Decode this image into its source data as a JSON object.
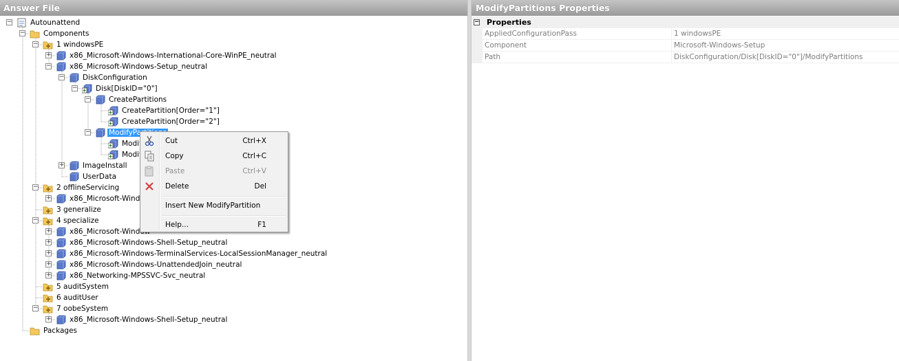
{
  "left_panel": {
    "title": "Answer File"
  },
  "right_panel": {
    "title": "ModifyPartitions Properties"
  },
  "tree": [
    {
      "label": "Autounattend",
      "icon": "answer-file-icon",
      "expander": "minus"
    },
    {
      "label": "Components",
      "icon": "folder-icon",
      "expander": "minus"
    },
    {
      "label": "1 windowsPE",
      "icon": "configuration-pass-icon",
      "expander": "minus"
    },
    {
      "label": "x86_Microsoft-Windows-International-Core-WinPE_neutral",
      "icon": "component-icon",
      "expander": "plus"
    },
    {
      "label": "x86_Microsoft-Windows-Setup_neutral",
      "icon": "component-icon",
      "expander": "minus"
    },
    {
      "label": "DiskConfiguration",
      "icon": "component-icon",
      "expander": "minus"
    },
    {
      "label": "Disk[DiskID=\"0\"]",
      "icon": "list-item-icon",
      "expander": "minus"
    },
    {
      "label": "CreatePartitions",
      "icon": "component-icon",
      "expander": "minus"
    },
    {
      "label": "CreatePartition[Order=\"1\"]",
      "icon": "list-item-icon",
      "expander": ""
    },
    {
      "label": "CreatePartition[Order=\"2\"]",
      "icon": "list-item-icon",
      "expander": ""
    },
    {
      "label": "ModifyPartitions",
      "icon": "component-icon",
      "expander": "minus",
      "selected": true
    },
    {
      "label": "Modify",
      "icon": "list-item-icon",
      "expander": ""
    },
    {
      "label": "Modify",
      "icon": "list-item-icon",
      "expander": ""
    },
    {
      "label": "ImageInstall",
      "icon": "component-icon",
      "expander": "plus"
    },
    {
      "label": "UserData",
      "icon": "component-icon",
      "expander": ""
    },
    {
      "label": "2 offlineServicing",
      "icon": "configuration-pass-icon",
      "expander": "minus"
    },
    {
      "label": "x86_Microsoft-Window",
      "icon": "component-icon",
      "expander": "plus"
    },
    {
      "label": "3 generalize",
      "icon": "configuration-pass-icon",
      "expander": ""
    },
    {
      "label": "4 specialize",
      "icon": "configuration-pass-icon",
      "expander": "minus"
    },
    {
      "label": "x86_Microsoft-Window",
      "icon": "component-icon",
      "expander": "plus"
    },
    {
      "label": "x86_Microsoft-Windows-Shell-Setup_neutral",
      "icon": "component-icon",
      "expander": "plus"
    },
    {
      "label": "x86_Microsoft-Windows-TerminalServices-LocalSessionManager_neutral",
      "icon": "component-icon",
      "expander": "plus"
    },
    {
      "label": "x86_Microsoft-Windows-UnattendedJoin_neutral",
      "icon": "component-icon",
      "expander": "plus"
    },
    {
      "label": "x86_Networking-MPSSVC-Svc_neutral",
      "icon": "component-icon",
      "expander": "plus"
    },
    {
      "label": "5 auditSystem",
      "icon": "configuration-pass-icon",
      "expander": ""
    },
    {
      "label": "6 auditUser",
      "icon": "configuration-pass-icon",
      "expander": ""
    },
    {
      "label": "7 oobeSystem",
      "icon": "configuration-pass-icon",
      "expander": "minus"
    },
    {
      "label": "x86_Microsoft-Windows-Shell-Setup_neutral",
      "icon": "component-icon",
      "expander": "plus"
    },
    {
      "label": "Packages",
      "icon": "folder-icon",
      "expander": ""
    }
  ],
  "context_menu": {
    "items": [
      {
        "label": "Cut",
        "shortcut": "Ctrl+X",
        "icon": "cut-icon",
        "enabled": true
      },
      {
        "label": "Copy",
        "shortcut": "Ctrl+C",
        "icon": "copy-icon",
        "enabled": true
      },
      {
        "label": "Paste",
        "shortcut": "Ctrl+V",
        "icon": "paste-icon",
        "enabled": false
      },
      {
        "label": "Delete",
        "shortcut": "Del",
        "icon": "delete-icon",
        "enabled": true
      },
      {
        "label": "Insert New ModifyPartition",
        "shortcut": "",
        "icon": "",
        "enabled": true
      },
      {
        "label": "Help...",
        "shortcut": "F1",
        "icon": "",
        "enabled": true
      }
    ]
  },
  "properties": {
    "category": "Properties",
    "category_expander": "minus",
    "rows": [
      {
        "name": "AppliedConfigurationPass",
        "value": "1 windowsPE"
      },
      {
        "name": "Component",
        "value": "Microsoft-Windows-Setup"
      },
      {
        "name": "Path",
        "value": "DiskConfiguration/Disk[DiskID=\"0\"]/ModifyPartitions"
      }
    ]
  },
  "colors": {
    "selection": "#3399ff",
    "header_gradient_top": "#c4c4c4",
    "header_gradient_bottom": "#9a9a9a",
    "component_icon": "#5b79c9",
    "folder_icon": "#f4c95a",
    "delete_icon": "#d2403c"
  }
}
